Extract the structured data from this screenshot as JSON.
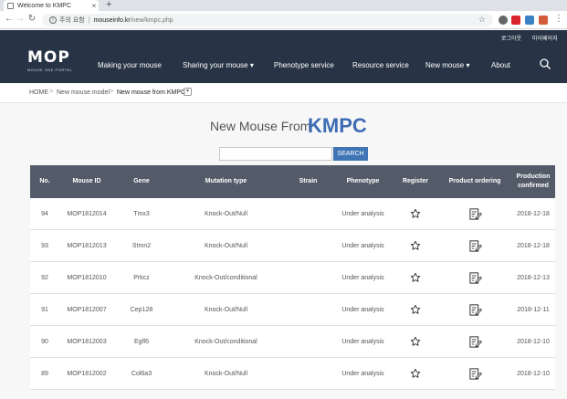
{
  "browser": {
    "tab_title": "Welcome to KMPC",
    "tab_close": "×",
    "new_tab": "+",
    "security_label": "주의 요함",
    "url_host": "mouseinfo.kr",
    "url_path": "/new/kmpc.php"
  },
  "header": {
    "util_links": [
      "로그아웃",
      "마이페이지"
    ],
    "logo_text": "MOP",
    "logo_subtext": "MOUSE ONE PORTAL",
    "menu": [
      "Making your mouse",
      "Sharing your mouse ▾",
      "Phenotype service",
      "Resource service",
      "New mouse ▾",
      "About"
    ],
    "search_icon": "search-icon"
  },
  "breadcrumb": {
    "home": "HOME",
    "level1": "New mouse model",
    "level2": "New mouse from KMPC",
    "separator": ">",
    "dropdown_icon": "chevron-down-icon"
  },
  "page": {
    "title": "New Mouse From",
    "brand": "KMPC",
    "search_placeholder": "",
    "search_button": "SEARCH"
  },
  "table": {
    "headers": [
      "No.",
      "Mouse ID",
      "Gene",
      "Mutation type",
      "Strain",
      "Phenotype",
      "Register",
      "Product ordering",
      "Production confirmed"
    ],
    "rows": [
      {
        "no": "94",
        "mouse_id": "MOP1812014",
        "gene": "Tmx3",
        "mutation": "Knock-Out/Null",
        "strain": "",
        "phenotype": "Under analysis",
        "date": "2018-12-18"
      },
      {
        "no": "93",
        "mouse_id": "MOP1812013",
        "gene": "Stmn2",
        "mutation": "Knock-Out/Null",
        "strain": "",
        "phenotype": "Under analysis",
        "date": "2018-12-18"
      },
      {
        "no": "92",
        "mouse_id": "MOP1812010",
        "gene": "Prkcz",
        "mutation": "Knock-Out/conditional",
        "strain": "",
        "phenotype": "Under analysis",
        "date": "2018-12-13"
      },
      {
        "no": "91",
        "mouse_id": "MOP1812007",
        "gene": "Cep128",
        "mutation": "Knock-Out/Null",
        "strain": "",
        "phenotype": "Under analysis",
        "date": "2018-12-11"
      },
      {
        "no": "90",
        "mouse_id": "MOP1812003",
        "gene": "Egfl6",
        "mutation": "Knock-Out/conditional",
        "strain": "",
        "phenotype": "Under analysis",
        "date": "2018-12-10"
      },
      {
        "no": "89",
        "mouse_id": "MOP1812002",
        "gene": "Col6a3",
        "mutation": "Knock-Out/Null",
        "strain": "",
        "phenotype": "Under analysis",
        "date": "2018-12-10"
      }
    ]
  },
  "colors": {
    "header_bg": "#283446",
    "table_header_bg": "#535b69",
    "search_button_bg": "#3f75b5",
    "brand_blue": "#3f6db3"
  }
}
